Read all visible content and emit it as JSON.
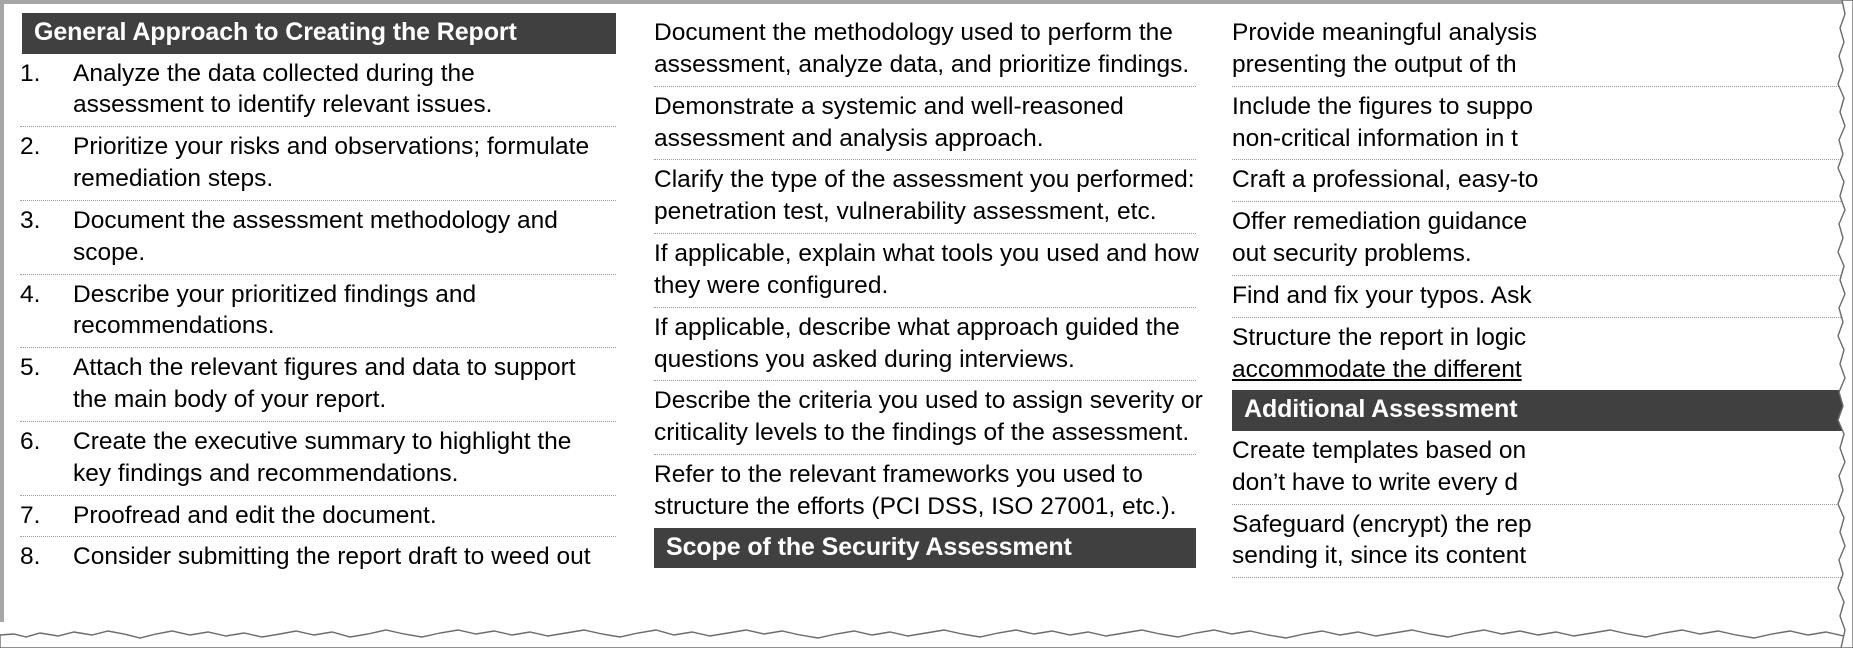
{
  "document": {
    "title_bar_color": "#404040",
    "title_bar_text_color": "#ffffff",
    "separator_color": "#9a9a9a",
    "page_edge_color": "#a6a6a6"
  },
  "columns": [
    {
      "id": "column-left",
      "heading": "General Approach to Creating the Report",
      "items": [
        {
          "number": "1.",
          "lines": [
            "Analyze the data collected during the",
            "assessment to identify relevant issues."
          ]
        },
        {
          "number": "2.",
          "lines": [
            "Prioritize your risks and observations; formulate",
            "remediation steps."
          ]
        },
        {
          "number": "3.",
          "lines": [
            "Document the assessment methodology and",
            "scope."
          ]
        },
        {
          "number": "4.",
          "lines": [
            "Describe your prioritized findings and",
            "recommendations."
          ]
        },
        {
          "number": "5.",
          "lines": [
            "Attach the relevant figures and data to support",
            "the main body of your report."
          ]
        },
        {
          "number": "6.",
          "lines": [
            "Create the executive summary to highlight the",
            "key findings and recommendations."
          ]
        },
        {
          "number": "7.",
          "lines": [
            "Proofread and edit the document."
          ]
        },
        {
          "number": "8.",
          "lines": [
            "Consider submitting the report draft to weed out"
          ]
        }
      ]
    },
    {
      "id": "column-middle",
      "heading": "Scope of the Security Assessment",
      "items": [
        {
          "lines": [
            "Document the methodology used to perform the",
            "assessment, analyze data, and prioritize findings."
          ]
        },
        {
          "lines": [
            "Demonstrate a systemic and well-reasoned",
            "assessment and analysis approach."
          ]
        },
        {
          "lines": [
            "Clarify the type of the assessment you performed:",
            "penetration test, vulnerability assessment, etc."
          ]
        },
        {
          "lines": [
            "If applicable, explain what tools you used and how",
            "they were configured."
          ]
        },
        {
          "lines": [
            "If applicable, describe what approach guided the",
            "questions you asked during interviews."
          ]
        },
        {
          "lines": [
            "Describe the criteria you used to assign severity or",
            "criticality levels to the findings of the assessment."
          ]
        },
        {
          "lines": [
            "Refer to the relevant frameworks you used to",
            "structure the efforts (PCI DSS, ISO 27001, etc.)."
          ]
        }
      ]
    },
    {
      "id": "column-right",
      "heading": "Additional Assessment",
      "items_before_heading": [
        {
          "lines": [
            "Provide meaningful analysis",
            "presenting the output of th"
          ]
        },
        {
          "lines": [
            "Include the figures to suppo",
            "non-critical information in t"
          ]
        },
        {
          "lines": [
            "Craft a professional, easy-to"
          ]
        },
        {
          "lines": [
            "Offer remediation guidance",
            "out security problems."
          ]
        },
        {
          "lines": [
            "Find and fix your typos. Ask"
          ]
        },
        {
          "lines": [
            "Structure the report in logic",
            "accommodate the different"
          ],
          "underline_last": true
        }
      ],
      "items_after_heading": [
        {
          "lines": [
            "Create templates based on",
            "don’t have to write every d"
          ]
        },
        {
          "lines": [
            "Safeguard (encrypt) the rep",
            "sending it, since its content"
          ]
        }
      ]
    }
  ]
}
